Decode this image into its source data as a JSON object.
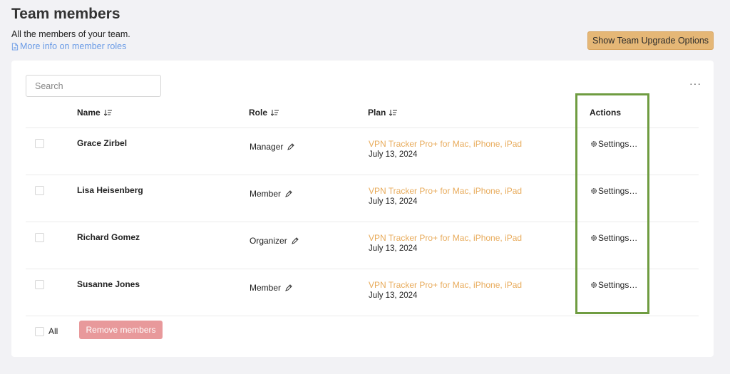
{
  "header": {
    "title": "Team members",
    "subtitle": "All the members of your team.",
    "info_link": "More info on member roles",
    "upgrade_button": "Show Team Upgrade Options"
  },
  "toolbar": {
    "search_placeholder": "Search",
    "more_menu": "···"
  },
  "columns": {
    "name": "Name",
    "role": "Role",
    "plan": "Plan",
    "actions": "Actions"
  },
  "rows": [
    {
      "name": "Grace Zirbel",
      "role": "Manager",
      "plan": "VPN Tracker Pro+ for Mac, iPhone, iPad",
      "date": "July 13, 2024",
      "action": "Settings…"
    },
    {
      "name": "Lisa Heisenberg",
      "role": "Member",
      "plan": "VPN Tracker Pro+ for Mac, iPhone, iPad",
      "date": "July 13, 2024",
      "action": "Settings…"
    },
    {
      "name": "Richard Gomez",
      "role": "Organizer",
      "plan": "VPN Tracker Pro+ for Mac, iPhone, iPad",
      "date": "July 13, 2024",
      "action": "Settings…"
    },
    {
      "name": "Susanne Jones",
      "role": "Member",
      "plan": "VPN Tracker Pro+ for Mac, iPhone, iPad",
      "date": "July 13, 2024",
      "action": "Settings…"
    }
  ],
  "footer": {
    "select_all_label": "All",
    "remove_button": "Remove members"
  },
  "colors": {
    "accent_orange": "#e5b776",
    "plan_text": "#e8ab5b",
    "link_blue": "#6a9be6",
    "remove_button": "#e8999b",
    "highlight_green": "#6f9c41"
  }
}
